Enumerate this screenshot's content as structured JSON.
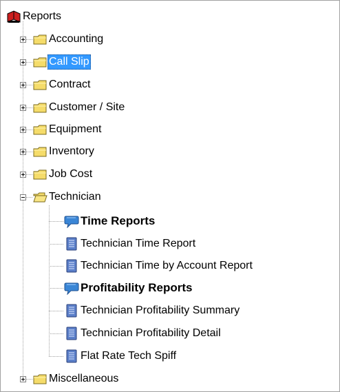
{
  "tree": {
    "root": {
      "label": "Reports",
      "icon": "reports-book-icon"
    },
    "folders_top": [
      {
        "label": "Accounting",
        "icon": "folder-icon"
      },
      {
        "label": "Call Slip",
        "icon": "folder-icon",
        "selected": true
      },
      {
        "label": "Contract",
        "icon": "folder-icon"
      },
      {
        "label": "Customer / Site",
        "icon": "folder-icon"
      },
      {
        "label": "Equipment",
        "icon": "folder-icon"
      },
      {
        "label": "Inventory",
        "icon": "folder-icon"
      },
      {
        "label": "Job Cost",
        "icon": "folder-icon"
      }
    ],
    "technician": {
      "label": "Technician",
      "icon": "folder-open-icon",
      "children": [
        {
          "label": "Time Reports",
          "type": "group",
          "icon": "speech-bubble-icon"
        },
        {
          "label": "Technician Time Report",
          "type": "report",
          "icon": "report-document-icon"
        },
        {
          "label": "Technician Time by Account Report",
          "type": "report",
          "icon": "report-document-icon"
        },
        {
          "label": "Profitability Reports",
          "type": "group",
          "icon": "speech-bubble-icon"
        },
        {
          "label": "Technician Profitability Summary",
          "type": "report",
          "icon": "report-document-icon"
        },
        {
          "label": "Technician Profitability Detail",
          "type": "report",
          "icon": "report-document-icon"
        },
        {
          "label": "Flat Rate Tech Spiff",
          "type": "report",
          "icon": "report-document-icon"
        }
      ]
    },
    "misc": {
      "label": "Miscellaneous",
      "icon": "folder-icon"
    }
  },
  "colors": {
    "selection": "#3399ff",
    "folder": "#f5dc6a",
    "document": "#5b7fc9",
    "bubble": "#3a86d6",
    "book": "#cc1f1f"
  }
}
